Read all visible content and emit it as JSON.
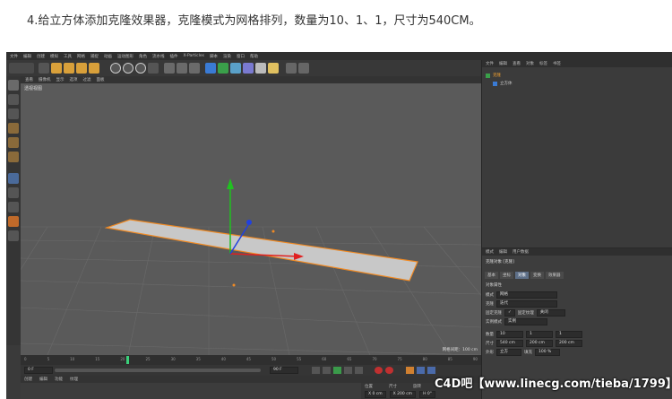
{
  "caption": "4.给立方体添加克隆效果器，克隆模式为网格排列，数量为10、1、1，尺寸为540CM。",
  "menubar": [
    "文件",
    "编辑",
    "创建",
    "模拟",
    "工具",
    "网格",
    "捕捉",
    "动画",
    "运动图形",
    "角色",
    "流水线",
    "插件",
    "X-Particles",
    "脚本",
    "渲染",
    "窗口",
    "帮助"
  ],
  "viewport": {
    "menu": [
      "查看",
      "摄像机",
      "显示",
      "选项",
      "过滤",
      "面板"
    ],
    "label": "透视视图",
    "info": "网格间距：100 cm"
  },
  "timeline": {
    "ticks": [
      "0",
      "5",
      "10",
      "15",
      "20",
      "25",
      "30",
      "35",
      "40",
      "45",
      "50",
      "55",
      "60",
      "65",
      "70",
      "75",
      "80",
      "85",
      "90"
    ],
    "start_field": "0 F",
    "end_field": "90 F",
    "current": "0 F"
  },
  "materials": {
    "menu": [
      "创建",
      "编辑",
      "功能",
      "纹理"
    ]
  },
  "coords": {
    "header": [
      "位置",
      "尺寸",
      "旋转"
    ],
    "row": [
      "X 0 cm",
      "X 200 cm",
      "H 0°"
    ]
  },
  "objects_panel": {
    "tabs": [
      "文件",
      "编辑",
      "查看",
      "对象",
      "标签",
      "书签"
    ],
    "items": [
      "克隆",
      "立方体"
    ]
  },
  "attributes": {
    "tabs_top": [
      "模式",
      "编辑",
      "用户数据"
    ],
    "title": "克隆对象 [克隆]",
    "tabs": [
      "基本",
      "坐标",
      "对象",
      "变换",
      "效果器"
    ],
    "active_tab": "对象",
    "section": "对象属性",
    "rows": [
      {
        "label": "模式",
        "value": "网格"
      },
      {
        "label": "克隆",
        "value": "迭代"
      },
      {
        "label": "固定克隆",
        "value": "✓"
      },
      {
        "label": "固定纹理",
        "value": "关闭"
      },
      {
        "label": "实例模式",
        "value": "实例"
      }
    ],
    "count_label": "数量",
    "count": [
      "10",
      "1",
      "1"
    ],
    "size_label": "尺寸",
    "size": [
      "540 cm",
      "200 cm",
      "200 cm"
    ],
    "shape_label": "外形",
    "shape": "立方",
    "fill_label": "填充",
    "fill": "100 %"
  },
  "watermark": "C4D吧【www.linecg.com/tieba/1799】",
  "colors": {
    "viewport_bg": "#5a5a5a",
    "plane_fill": "#c8c8c8",
    "plane_edge": "#f08a24",
    "axis_x": "#e02020",
    "axis_y": "#20c020",
    "axis_z": "#2040e0"
  }
}
